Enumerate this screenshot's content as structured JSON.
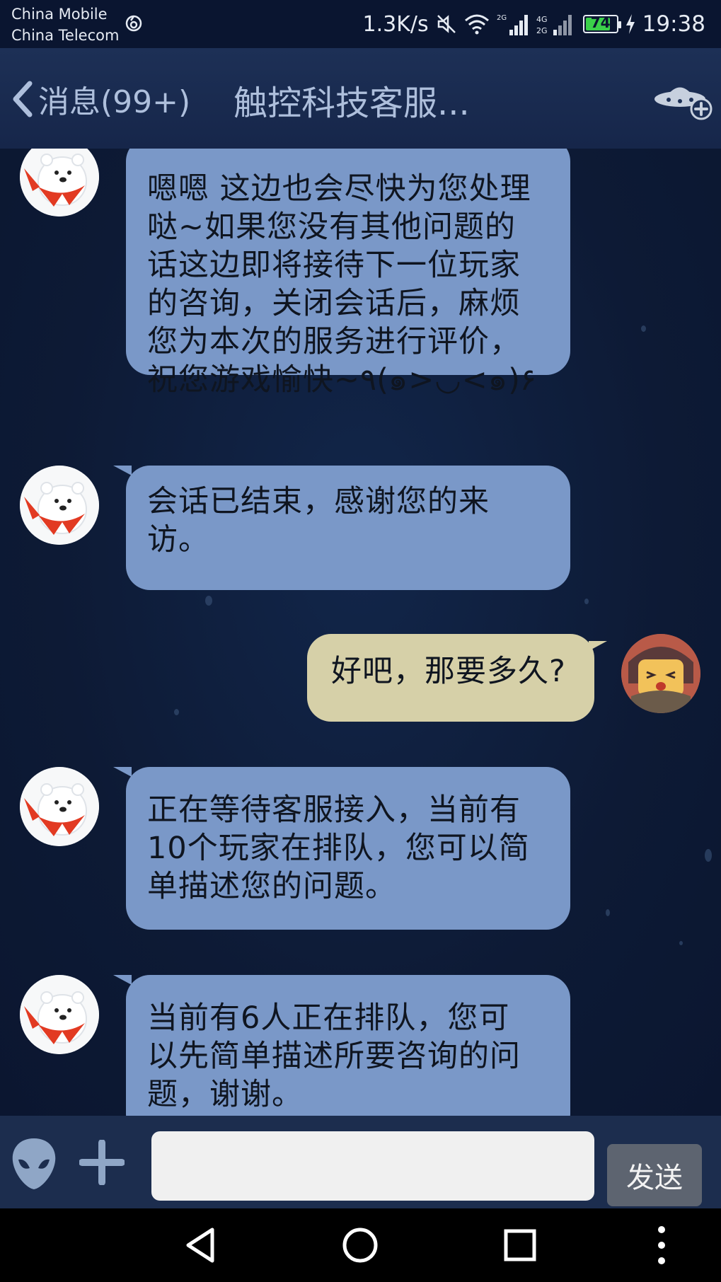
{
  "status_bar": {
    "carrier1": "China Mobile",
    "carrier2": "China Telecom",
    "net_speed": "1.3K/s",
    "signal1_label": "2G",
    "signal2_label": "4G 2G",
    "battery": "74",
    "time": "19:38"
  },
  "header": {
    "back_label": "消息(99+)",
    "title": "触控科技客服..."
  },
  "messages": [
    {
      "side": "in",
      "lines": [
        "嗯嗯 这边也会尽快为您处理",
        "哒~如果您没有其他问题的",
        "话这边即将接待下一位玩家",
        "的咨询，关闭会话后，麻烦",
        "您为本次的服务进行评价，",
        "祝您游戏愉快~٩(๑>◡<๑)۶"
      ]
    },
    {
      "side": "in",
      "lines": [
        "会话已结束，感谢您的来",
        "访。"
      ]
    },
    {
      "side": "out",
      "lines": [
        "好吧，那要多久?"
      ]
    },
    {
      "side": "in",
      "lines": [
        "正在等待客服接入，当前有",
        "10个玩家在排队，您可以简",
        "单描述您的问题。"
      ]
    },
    {
      "side": "in",
      "lines": [
        "当前有6人正在排队，您可",
        "以先简单描述所要咨询的问",
        "题，谢谢。"
      ]
    }
  ],
  "input": {
    "value": "",
    "send_label": "发送"
  },
  "icons": {
    "back": "chevron-left-icon",
    "ufo": "ufo-add-icon",
    "alien": "alien-emoji-icon",
    "plus": "plus-icon"
  },
  "colors": {
    "incoming_bubble": "#7a98c8",
    "outgoing_bubble": "#d6d0a8",
    "background": "#0d1a33",
    "header": "#1d3056"
  }
}
